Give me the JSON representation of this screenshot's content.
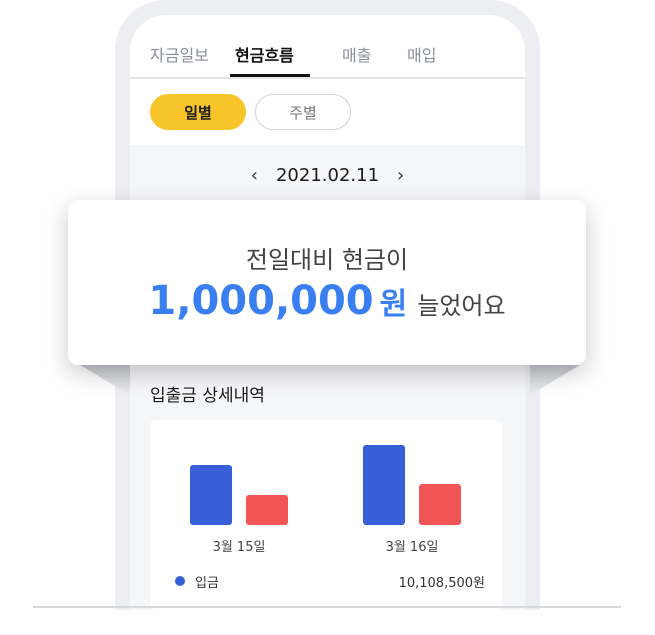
{
  "tabs": [
    {
      "label": "자금일보",
      "active": false
    },
    {
      "label": "현금흐름",
      "active": true
    },
    {
      "label": "매출",
      "active": false
    },
    {
      "label": "매입",
      "active": false
    }
  ],
  "period_toggle": {
    "daily": "일별",
    "weekly": "주별",
    "selected": "일별"
  },
  "date_nav": {
    "date": "2021.02.11",
    "prev_icon": "chevron-left-icon",
    "next_icon": "chevron-right-icon"
  },
  "popup": {
    "line1": "전일대비 현금이",
    "amount": "1,000,000",
    "unit": "원",
    "suffix": "늘었어요"
  },
  "detail": {
    "title": "입출금 상세내역",
    "legend": {
      "label": "입금",
      "value": "10,108,500원"
    }
  },
  "colors": {
    "accent": "#f7c529",
    "deposit": "#3760d8",
    "withdraw": "#f25555",
    "amount": "#3a7ff2"
  },
  "chart_data": {
    "type": "bar",
    "categories": [
      "3월 15일",
      "3월 16일"
    ],
    "series": [
      {
        "name": "입금",
        "values": [
          60,
          80
        ]
      },
      {
        "name": "",
        "values": [
          30,
          41
        ]
      }
    ],
    "ylim": [
      0,
      100
    ]
  }
}
